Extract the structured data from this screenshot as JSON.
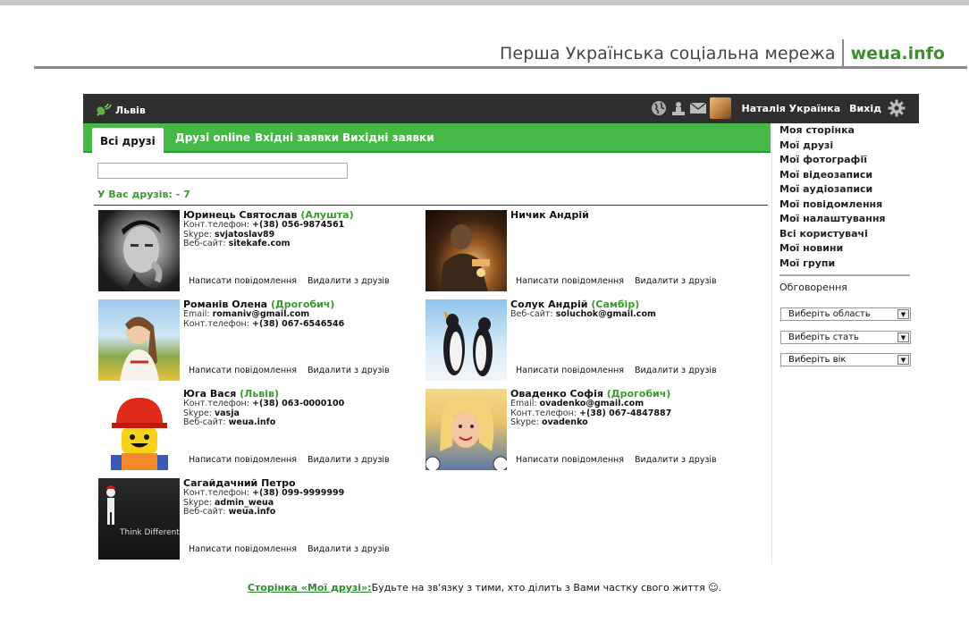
{
  "header": {
    "title": "Перша Українська соціальна мережа",
    "brand": "weua.info"
  },
  "topbar": {
    "city": "Львів",
    "user_name": "Наталія Українка",
    "logout": "Вихід",
    "icons": [
      "globe-icon",
      "users-icon",
      "mail-icon",
      "user-avatar",
      "gear-icon"
    ]
  },
  "tabs": [
    {
      "label": "Всі друзі",
      "active": true
    },
    {
      "label": "Друзі online",
      "active": false
    },
    {
      "label": "Вхідні заявки",
      "active": false
    },
    {
      "label": "Вихідні заявки",
      "active": false
    }
  ],
  "search": {
    "value": "",
    "placeholder": ""
  },
  "friends_count_label": "У Вас друзів: - 7",
  "friends": [
    {
      "name": "Юринець Святослав",
      "town": "(Алушта)",
      "lines": [
        [
          "Конт.телефон:",
          "+(38) 056-9874561"
        ],
        [
          "Skype:",
          "svjatoslav89"
        ],
        [
          "Веб-сайт:",
          "sitekafe.com"
        ]
      ],
      "write": "Написати повідомлення",
      "remove": "Видалити з друзів"
    },
    {
      "name": "Ничик Андрій",
      "town": "",
      "lines": [],
      "write": "Написати повідомлення",
      "remove": "Видалити з друзів"
    },
    {
      "name": "Романів Олена",
      "town": "(Дрогобич)",
      "lines": [
        [
          "Email:",
          "romaniv@gmail.com"
        ],
        [
          "Конт.телефон:",
          "+(38) 067-6546546"
        ]
      ],
      "write": "Написати повідомлення",
      "remove": "Видалити з друзів"
    },
    {
      "name": "Солук Андрій",
      "town": "(Самбір)",
      "lines": [
        [
          "Веб-сайт:",
          "soluchok@gmail.com"
        ]
      ],
      "write": "Написати повідомлення",
      "remove": "Видалити з друзів"
    },
    {
      "name": "Юга Вася",
      "town": "(Львів)",
      "lines": [
        [
          "Конт.телефон:",
          "+(38) 063-0000100"
        ],
        [
          "Skype:",
          "vasja"
        ],
        [
          "Веб-сайт:",
          "weua.info"
        ]
      ],
      "write": "Написати повідомлення",
      "remove": "Видалити з друзів"
    },
    {
      "name": "Оваденко Софія",
      "town": "(Дрогобич)",
      "lines": [
        [
          "Email:",
          "ovadenko@gmail.com"
        ],
        [
          "Конт.телефон:",
          "+(38) 067-4847887"
        ],
        [
          "Skype:",
          "ovadenko"
        ]
      ],
      "write": "Написати повідомлення",
      "remove": "Видалити з друзів"
    },
    {
      "name": "Сагайдачний Петро",
      "town": "",
      "lines": [
        [
          "Конт.телефон:",
          "+(38) 099-9999999"
        ],
        [
          "Skype:",
          "admin_weua"
        ],
        [
          "Веб-сайт:",
          "weua.info"
        ]
      ],
      "write": "Написати повідомлення",
      "remove": "Видалити з друзів",
      "photo_text": "Think  Different"
    }
  ],
  "sidebar": {
    "menu": [
      "Моя сторінка",
      "Мої друзі",
      "Мої фотографії",
      "Мої відеозаписи",
      "Мої аудіозаписи",
      "Мої повідомлення",
      "Мої налаштування",
      "Всі користувачі",
      "Мої новини",
      "Мої групи"
    ],
    "discussions": "Обговорення",
    "selects": [
      "Виберіть область",
      "Виберіть стать",
      "Виберіть вік"
    ]
  },
  "footer": {
    "link": "Сторінка «Мої друзі»:",
    "text": "Будьте на зв'язку з тими, хто ділить з Вами частку свого життя ☺."
  }
}
